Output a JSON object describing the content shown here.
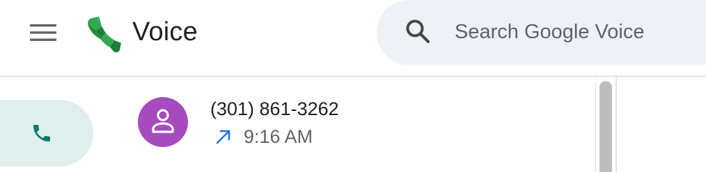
{
  "header": {
    "app_title": "Voice",
    "menu_icon": "hamburger-menu-icon",
    "logo_icon": "google-voice-logo"
  },
  "search": {
    "placeholder": "Search Google Voice",
    "value": "",
    "icon": "search-icon"
  },
  "nav": {
    "calls": {
      "icon": "phone-icon",
      "selected": true,
      "highlight_color": "#e0efee",
      "icon_color": "#00796b"
    }
  },
  "calls": [
    {
      "number": "(301) 861-3262",
      "direction": "outgoing",
      "direction_icon": "outgoing-call-arrow-icon",
      "time": "9:16 AM",
      "avatar_icon": "person-icon",
      "avatar_color": "#a64bbd"
    }
  ],
  "colors": {
    "search_bg": "#eef2f7",
    "title_text": "#202124",
    "secondary_text": "#5f6368",
    "outgoing_arrow": "#1a73e8"
  }
}
